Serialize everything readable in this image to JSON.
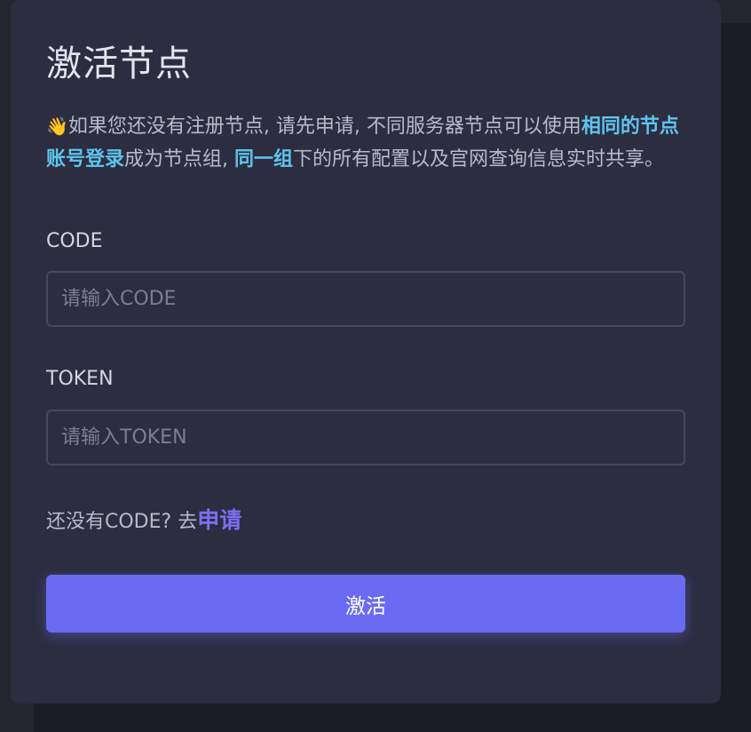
{
  "dialog": {
    "title": "激活节点",
    "intro": {
      "wave_icon": "👋",
      "text_1": "如果您还没有注册节点, 请先申请, 不同服务器节点可以使用",
      "highlight_1": "相同的节点账号登录",
      "text_2": "成为节点组, ",
      "highlight_2": "同一组",
      "text_3": "下的所有配置以及官网查询信息实时共享。"
    },
    "code_field": {
      "label": "CODE",
      "placeholder": "请输入CODE",
      "value": ""
    },
    "token_field": {
      "label": "TOKEN",
      "placeholder": "请输入TOKEN",
      "value": ""
    },
    "apply": {
      "prompt": "还没有CODE? 去",
      "link_label": "申请"
    },
    "activate_label": "激活"
  },
  "colors": {
    "card_bg": "#2c2d40",
    "highlight": "#5ec4ee",
    "accent": "#6a6af2",
    "link": "#7a6ff2"
  }
}
